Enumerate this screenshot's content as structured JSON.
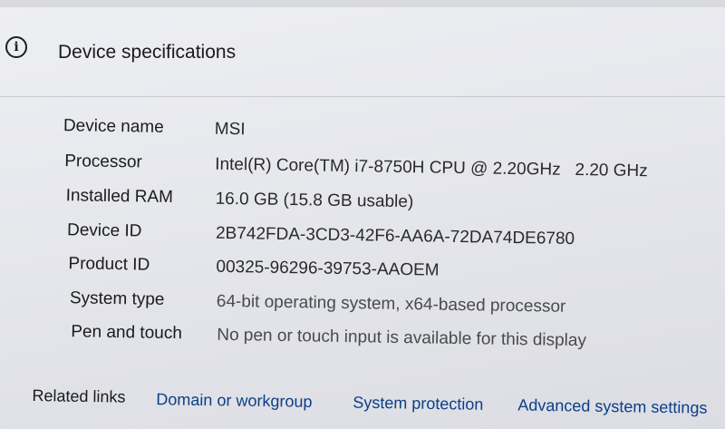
{
  "header": {
    "icon": "info-icon",
    "title": "Device specifications"
  },
  "specs": [
    {
      "label": "Device name",
      "value": "MSI"
    },
    {
      "label": "Processor",
      "value": "Intel(R) Core(TM) i7-8750H CPU @ 2.20GHz   2.20 GHz"
    },
    {
      "label": "Installed RAM",
      "value": "16.0 GB (15.8 GB usable)"
    },
    {
      "label": "Device ID",
      "value": "2B742FDA-3CD3-42F6-AA6A-72DA74DE6780"
    },
    {
      "label": "Product ID",
      "value": "00325-96296-39753-AAOEM"
    },
    {
      "label": "System type",
      "value": "64-bit operating system, x64-based processor"
    },
    {
      "label": "Pen and touch",
      "value": "No pen or touch input is available for this display"
    }
  ],
  "related": {
    "label": "Related links",
    "links": [
      "Domain or workgroup",
      "System protection",
      "Advanced system settings"
    ]
  }
}
